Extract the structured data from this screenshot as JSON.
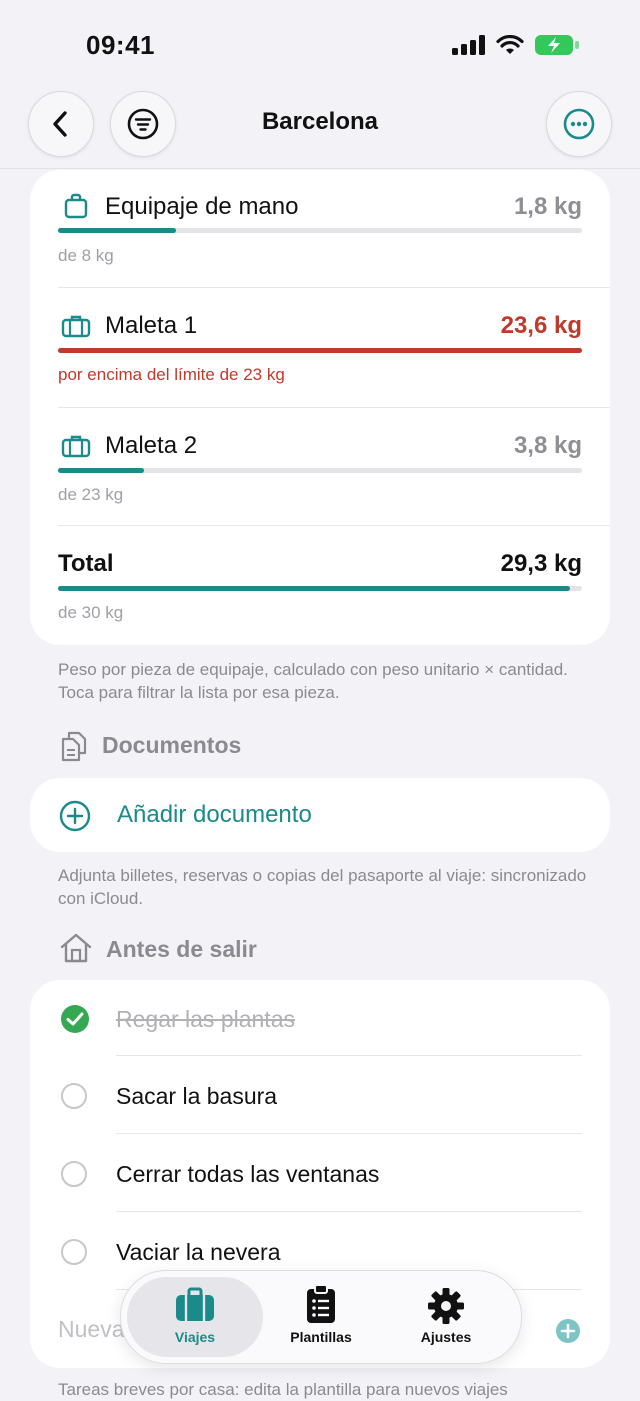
{
  "status": {
    "time": "09:41"
  },
  "header": {
    "title": "Barcelona"
  },
  "luggage": {
    "items": [
      {
        "label": "Equipaje de mano",
        "value": "1,8 kg",
        "limit": "de 8 kg",
        "fraction": 0.225,
        "over": false
      },
      {
        "label": "Maleta 1",
        "value": "23,6 kg",
        "limit": "por encima del límite de 23 kg",
        "fraction": 1.0,
        "over": true
      },
      {
        "label": "Maleta 2",
        "value": "3,8 kg",
        "limit": "de 23 kg",
        "fraction": 0.165,
        "over": false
      }
    ],
    "total": {
      "label": "Total",
      "value": "29,3 kg",
      "limit": "de 30 kg",
      "fraction": 0.977
    },
    "footnote": "Peso por pieza de equipaje, calculado con peso unitario × cantidad. Toca para filtrar la lista por esa pieza."
  },
  "documents": {
    "title": "Documentos",
    "add_label": "Añadir documento",
    "footnote": "Adjunta billetes, reservas o copias del pasaporte al viaje: sincronizado con iCloud."
  },
  "before": {
    "title": "Antes de salir",
    "tasks": [
      {
        "label": "Regar las plantas",
        "done": true
      },
      {
        "label": "Sacar la basura",
        "done": false
      },
      {
        "label": "Cerrar todas las ventanas",
        "done": false
      },
      {
        "label": "Vaciar la nevera",
        "done": false
      }
    ],
    "new_placeholder": "Nueva",
    "footnote": "Tareas breves por casa: edita la plantilla para nuevos viajes"
  },
  "tabs": [
    {
      "label": "Viajes",
      "icon": "suitcase-icon",
      "active": true
    },
    {
      "label": "Plantillas",
      "icon": "clipboard-list-icon",
      "active": false
    },
    {
      "label": "Ajustes",
      "icon": "gear-icon",
      "active": false
    }
  ],
  "colors": {
    "accent": "#1a8a8a",
    "danger": "#c0392b",
    "check": "#34a853",
    "background": "#f2f2f7"
  }
}
